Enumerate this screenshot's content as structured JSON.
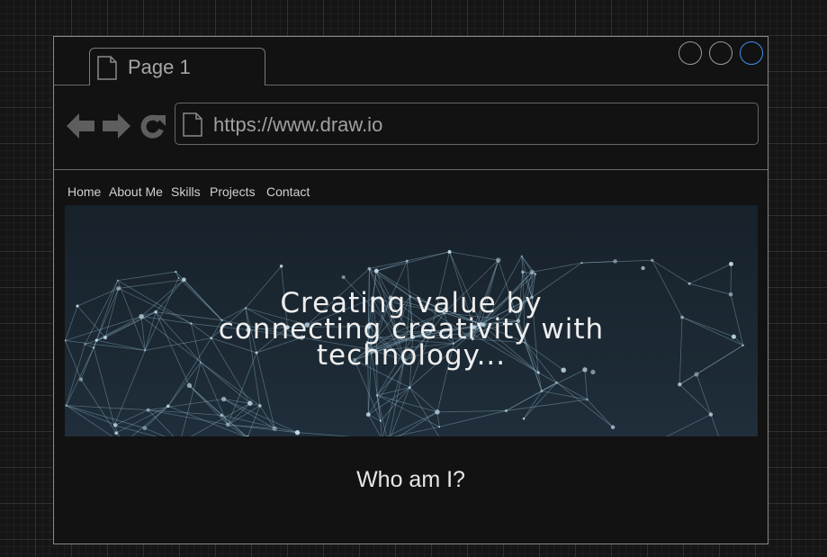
{
  "browser": {
    "tab_title": "Page 1",
    "url": "https://www.draw.io"
  },
  "nav": {
    "items": [
      "Home",
      "About Me",
      "Skills",
      "Projects",
      "Contact"
    ]
  },
  "hero": {
    "lines": [
      "Creating value by",
      "connecting creativity with",
      "technology..."
    ]
  },
  "section": {
    "heading": "Who am I?"
  },
  "colors": {
    "accent": "#3f8ee8",
    "hero_bg": "#17212a"
  }
}
